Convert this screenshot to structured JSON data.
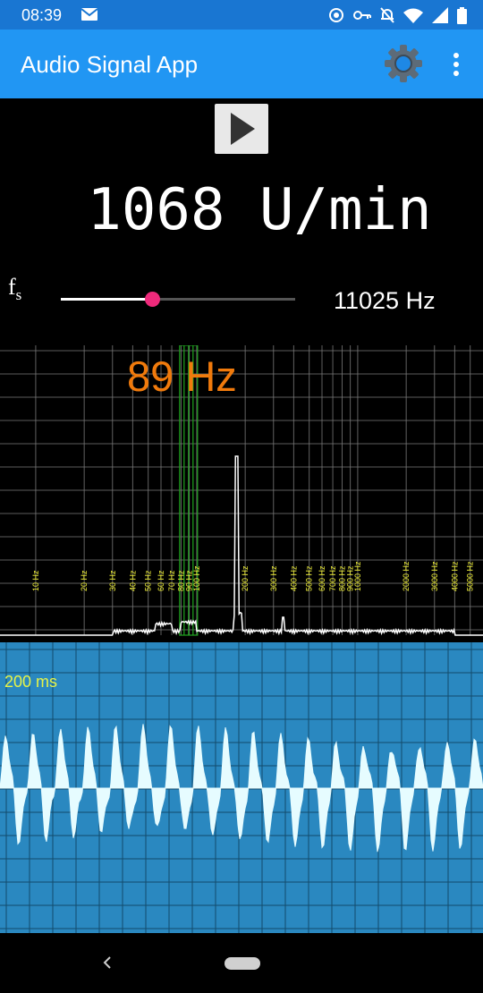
{
  "status_bar": {
    "time": "08:39",
    "icons": [
      "email-notification-icon",
      "sync-icon",
      "vpn-key-icon",
      "notifications-off-icon",
      "wifi-icon",
      "signal-icon",
      "battery-icon"
    ]
  },
  "app_bar": {
    "title": "Audio Signal App",
    "settings_icon": "gear-icon",
    "overflow_icon": "more-vert-icon"
  },
  "controls": {
    "play_icon": "play-icon",
    "rpm_display": "1068 U/min",
    "sample_rate_label": "f",
    "sample_rate_label_sub": "s",
    "sample_rate_value": "11025 Hz",
    "sample_rate_slider_fraction": 0.39
  },
  "spectrum": {
    "peak_frequency_label": "89 Hz",
    "axis_scale": "log",
    "freq_range": [
      6,
      6000
    ],
    "tick_labels": [
      {
        "freq": 10,
        "label": "10 Hz"
      },
      {
        "freq": 20,
        "label": "20 Hz"
      },
      {
        "freq": 30,
        "label": "30 Hz"
      },
      {
        "freq": 40,
        "label": "40 Hz"
      },
      {
        "freq": 50,
        "label": "50 Hz"
      },
      {
        "freq": 60,
        "label": "60 Hz"
      },
      {
        "freq": 70,
        "label": "70 Hz"
      },
      {
        "freq": 80,
        "label": "80 Hz"
      },
      {
        "freq": 90,
        "label": "90 Hz"
      },
      {
        "freq": 100,
        "label": "100 Hz"
      },
      {
        "freq": 200,
        "label": "200 Hz"
      },
      {
        "freq": 300,
        "label": "300 Hz"
      },
      {
        "freq": 400,
        "label": "400 Hz"
      },
      {
        "freq": 500,
        "label": "500 Hz"
      },
      {
        "freq": 600,
        "label": "600 Hz"
      },
      {
        "freq": 700,
        "label": "700 Hz"
      },
      {
        "freq": 800,
        "label": "800 Hz"
      },
      {
        "freq": 900,
        "label": "900 Hz"
      },
      {
        "freq": 1000,
        "label": "1000 Hz"
      },
      {
        "freq": 2000,
        "label": "2000 Hz"
      },
      {
        "freq": 3000,
        "label": "3000 Hz"
      },
      {
        "freq": 4000,
        "label": "4000 Hz"
      },
      {
        "freq": 5000,
        "label": "5000 Hz"
      }
    ],
    "highlight_freq": 89,
    "peak_freq": 178,
    "colors": {
      "grid": "#7a7a7a",
      "tick_label": "#f2f23a",
      "trace": "#ffffff",
      "highlight": "#1fa51f",
      "peak_label": "#f07a0c"
    }
  },
  "oscilloscope": {
    "time_label": "200 ms",
    "colors": {
      "background": "#2a88c0",
      "grid": "#134a6b",
      "trace": "#e6fcff"
    }
  },
  "nav_bar": {
    "back_icon": "back-icon",
    "home_icon": "home-pill-icon"
  }
}
